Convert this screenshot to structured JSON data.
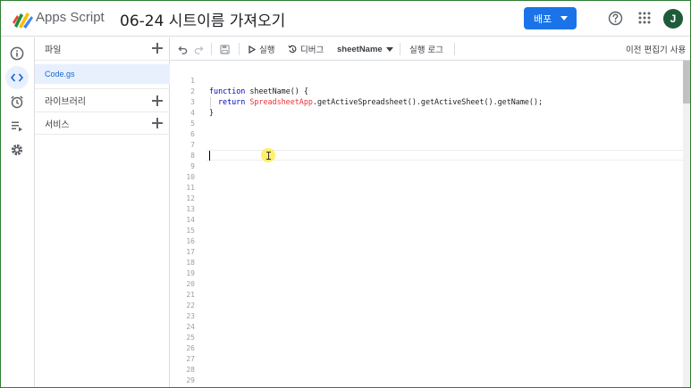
{
  "app": {
    "name": "Apps Script",
    "project_title": "06-24 시트이름 가져오기",
    "deploy_label": "배포",
    "avatar_initial": "J",
    "accent_color": "#1a73e8"
  },
  "rail": {
    "items": [
      {
        "icon": "info-icon"
      },
      {
        "icon": "code-icon",
        "active": true
      },
      {
        "icon": "alarm-clock-icon"
      },
      {
        "icon": "executions-icon"
      },
      {
        "icon": "gear-icon"
      }
    ]
  },
  "files_panel": {
    "files_label": "파일",
    "files": [
      "Code.gs"
    ],
    "libraries_label": "라이브러리",
    "services_label": "서비스"
  },
  "toolbar": {
    "run_label": "실행",
    "debug_label": "디버그",
    "function_select": "sheetName",
    "log_label": "실행 로그",
    "legacy_editor_label": "이전 편집기 사용"
  },
  "editor": {
    "line_numbers": [
      "1",
      "2",
      "3",
      "4",
      "5",
      "6",
      "7",
      "8",
      "9",
      "10",
      "11",
      "12",
      "13",
      "14",
      "15",
      "16",
      "17",
      "18",
      "19",
      "20",
      "21",
      "22",
      "23",
      "24",
      "25",
      "26",
      "27",
      "28",
      "29"
    ],
    "code": {
      "line2_kw": "function",
      "line2_rest": " sheetName() {",
      "line3_kw": "return",
      "line3_class": "SpreadsheetApp",
      "line3_rest": ".getActiveSpreadsheet().getActiveSheet().getName();",
      "line4": "}"
    }
  }
}
